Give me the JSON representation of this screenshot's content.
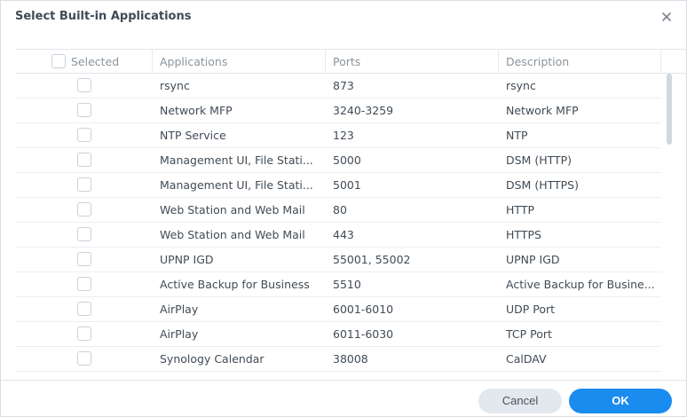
{
  "dialog": {
    "title": "Select Built-in Applications",
    "close_icon": "close-icon"
  },
  "table": {
    "headers": {
      "selected": "Selected",
      "applications": "Applications",
      "ports": "Ports",
      "description": "Description"
    },
    "rows": [
      {
        "selected": false,
        "app": "rsync",
        "ports": "873",
        "description": "rsync"
      },
      {
        "selected": false,
        "app": "Network MFP",
        "ports": "3240-3259",
        "description": "Network MFP"
      },
      {
        "selected": false,
        "app": "NTP Service",
        "ports": "123",
        "description": "NTP"
      },
      {
        "selected": false,
        "app": "Management UI, File Stati...",
        "ports": "5000",
        "description": "DSM (HTTP)"
      },
      {
        "selected": false,
        "app": "Management UI, File Stati...",
        "ports": "5001",
        "description": "DSM (HTTPS)"
      },
      {
        "selected": false,
        "app": "Web Station and Web Mail",
        "ports": "80",
        "description": "HTTP"
      },
      {
        "selected": false,
        "app": "Web Station and Web Mail",
        "ports": "443",
        "description": "HTTPS"
      },
      {
        "selected": false,
        "app": "UPNP IGD",
        "ports": "55001, 55002",
        "description": "UPNP IGD"
      },
      {
        "selected": false,
        "app": "Active Backup for Business",
        "ports": "5510",
        "description": "Active Backup for Busine..."
      },
      {
        "selected": false,
        "app": "AirPlay",
        "ports": "6001-6010",
        "description": "UDP Port"
      },
      {
        "selected": false,
        "app": "AirPlay",
        "ports": "6011-6030",
        "description": "TCP Port"
      },
      {
        "selected": false,
        "app": "Synology Calendar",
        "ports": "38008",
        "description": "CalDAV"
      }
    ]
  },
  "footer": {
    "cancel_label": "Cancel",
    "ok_label": "OK"
  },
  "colors": {
    "primary": "#1a8cf0",
    "cancel_bg": "#e3e8ee",
    "text": "#414b55",
    "header_text": "#8a939c"
  }
}
